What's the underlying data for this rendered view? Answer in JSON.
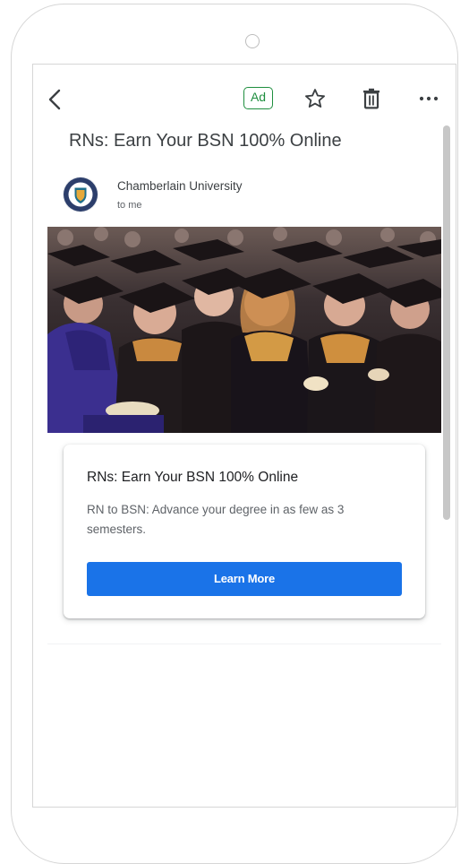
{
  "toolbar": {
    "back_icon": "arrow-back-icon",
    "ad_label": "Ad",
    "star_icon": "star-outline-icon",
    "trash_icon": "trash-icon",
    "more_icon": "more-horizontal-icon"
  },
  "email": {
    "subject": "RNs: Earn Your BSN 100% Online",
    "sender": "Chamberlain University",
    "recipient": "to me"
  },
  "ad_card": {
    "title": "RNs: Earn Your BSN 100% Online",
    "description": "RN to BSN: Advance your degree in as few as 3 semesters.",
    "cta_label": "Learn More"
  },
  "colors": {
    "ad_green": "#1e8e3e",
    "cta_blue": "#1a73e8",
    "text_dark": "#3c4043",
    "text_muted": "#5f6368"
  }
}
